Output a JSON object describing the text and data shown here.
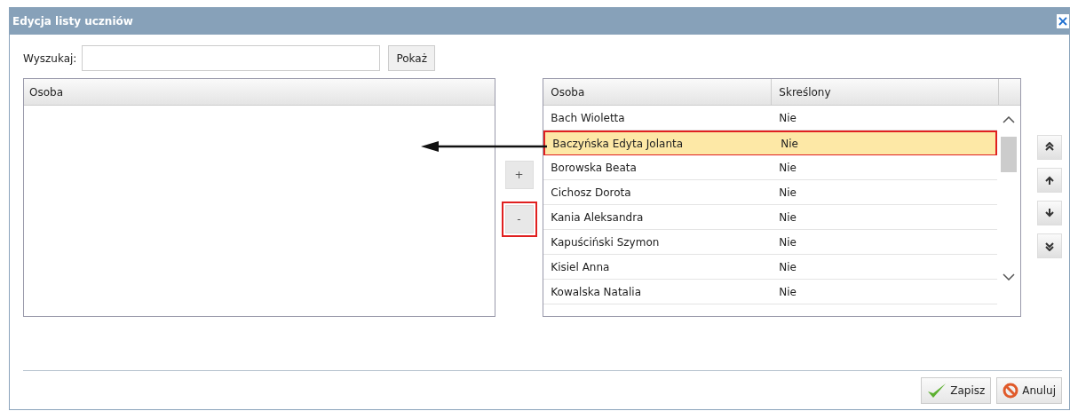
{
  "window": {
    "title": "Edycja listy uczniów",
    "close": "×"
  },
  "search": {
    "label": "Wyszukaj:",
    "button": "Pokaż"
  },
  "left_table": {
    "columns": [
      "Osoba"
    ]
  },
  "transfer_buttons": [
    {
      "label": "+",
      "highlighted": false
    },
    {
      "label": "-",
      "highlighted": true
    }
  ],
  "right_table": {
    "columns": [
      "Osoba",
      "Skreślony"
    ],
    "rows": [
      {
        "cells": [
          "Bach Wioletta",
          "Nie"
        ],
        "selected": false
      },
      {
        "cells": [
          "Baczyńska Edyta Jolanta",
          "Nie"
        ],
        "selected": true
      },
      {
        "cells": [
          "Borowska Beata",
          "Nie"
        ],
        "selected": false
      },
      {
        "cells": [
          "Cichosz Dorota",
          "Nie"
        ],
        "selected": false
      },
      {
        "cells": [
          "Kania Aleksandra",
          "Nie"
        ],
        "selected": false
      },
      {
        "cells": [
          "Kapuściński Szymon",
          "Nie"
        ],
        "selected": false
      },
      {
        "cells": [
          "Kisiel Anna",
          "Nie"
        ],
        "selected": false
      },
      {
        "cells": [
          "Kowalska Natalia",
          "Nie"
        ],
        "selected": false
      }
    ]
  },
  "order_buttons": [
    {
      "kind": "top"
    },
    {
      "kind": "up"
    },
    {
      "kind": "down"
    },
    {
      "kind": "bottom"
    }
  ],
  "footer": {
    "save": "Zapisz",
    "cancel": "Anuluj"
  }
}
